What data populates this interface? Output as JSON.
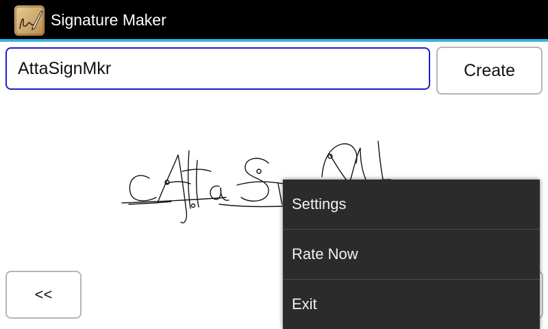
{
  "header": {
    "title": "Signature Maker",
    "icon": "quill-signature-icon",
    "bar_color": "#000000",
    "accent_color": "#33b5e5"
  },
  "form": {
    "name_value": "AttaSignMkr",
    "create_label": "Create"
  },
  "navigation": {
    "prev_label": "<<"
  },
  "signature": {
    "text": "AttaSignMkr",
    "style": "cursive-handwritten"
  },
  "menu": {
    "items": [
      {
        "label": "Settings"
      },
      {
        "label": "Rate Now"
      },
      {
        "label": "Exit"
      }
    ]
  }
}
